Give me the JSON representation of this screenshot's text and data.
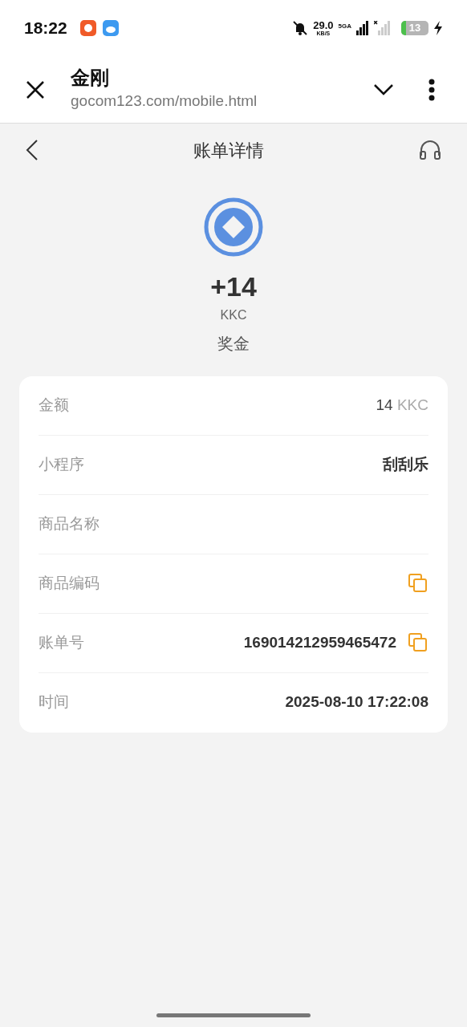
{
  "status_bar": {
    "time": "18:22",
    "net_speed": "29.0",
    "net_unit": "KB/S",
    "network": "5GA",
    "battery": "13"
  },
  "browser": {
    "title": "金刚",
    "url": "gocom123.com/mobile.html"
  },
  "header": {
    "title": "账单详情"
  },
  "summary": {
    "amount": "+14",
    "currency": "KKC",
    "type": "奖金"
  },
  "rows": [
    {
      "kind": "plain",
      "label": "金额",
      "value": "14",
      "unit": "KKC",
      "copy": false
    },
    {
      "kind": "bold",
      "label": "小程序",
      "value": "刮刮乐",
      "copy": false
    },
    {
      "label": "商品名称",
      "copy": false
    },
    {
      "label": "商品编码",
      "copy": true
    },
    {
      "kind": "bold",
      "label": "账单号",
      "value": "169014212959465472",
      "copy": true
    },
    {
      "kind": "bold",
      "label": "时间",
      "value": "2025-08-10 17:22:08",
      "copy": false
    }
  ]
}
